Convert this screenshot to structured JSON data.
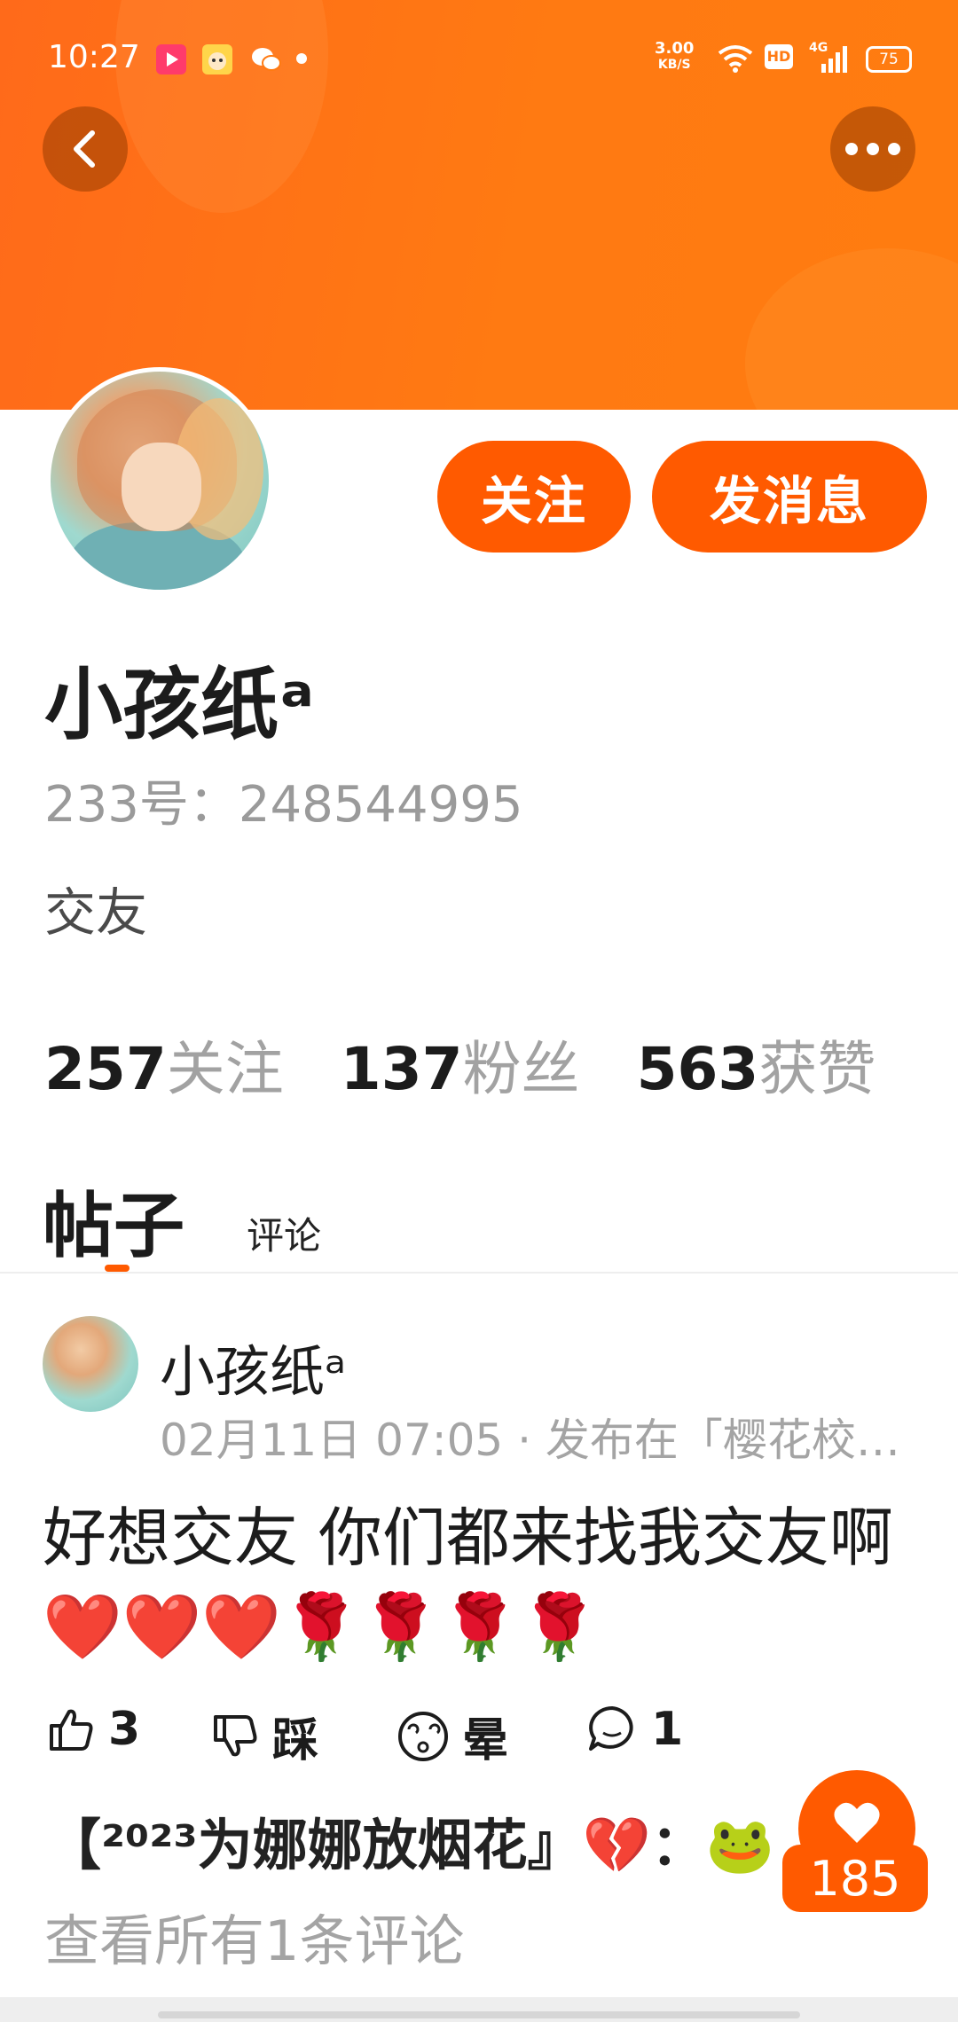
{
  "status_bar": {
    "time": "10:27",
    "net_speed": "3.00",
    "net_unit": "KB/S",
    "hd": "HD",
    "signal": "4G",
    "battery": "75"
  },
  "header": {
    "back_icon": "chevron-left-icon",
    "more_icon": "more-horizontal-icon",
    "banner_color": "#ff7a12"
  },
  "profile": {
    "follow_label": "关注",
    "message_label": "发消息",
    "nickname": "小孩纸ᵃ",
    "uid": "233号：248544995",
    "bio": "交友",
    "stats": [
      {
        "num": "257",
        "label": "关注"
      },
      {
        "num": "137",
        "label": "粉丝"
      },
      {
        "num": "563",
        "label": "获赞"
      }
    ]
  },
  "tabs": {
    "posts": "帖子",
    "comments": "评论",
    "active": "帖子"
  },
  "post": {
    "author": "小孩纸ᵃ",
    "meta": "02月11日 07:05 · 发布在「樱花校…",
    "text": "好想交友  你们都来找我交友啊❤️❤️❤️🌹🌹🌹🌹",
    "like_count": "3",
    "dislike_label": "踩",
    "dizzy_label": "晕",
    "comment_count": "1",
    "hot_comment": "【²⁰²³为娜娜放烟花』💔：🐸",
    "view_all": "查看所有1条评论"
  },
  "fab": {
    "count": "185",
    "accent": "#ff5a00"
  }
}
